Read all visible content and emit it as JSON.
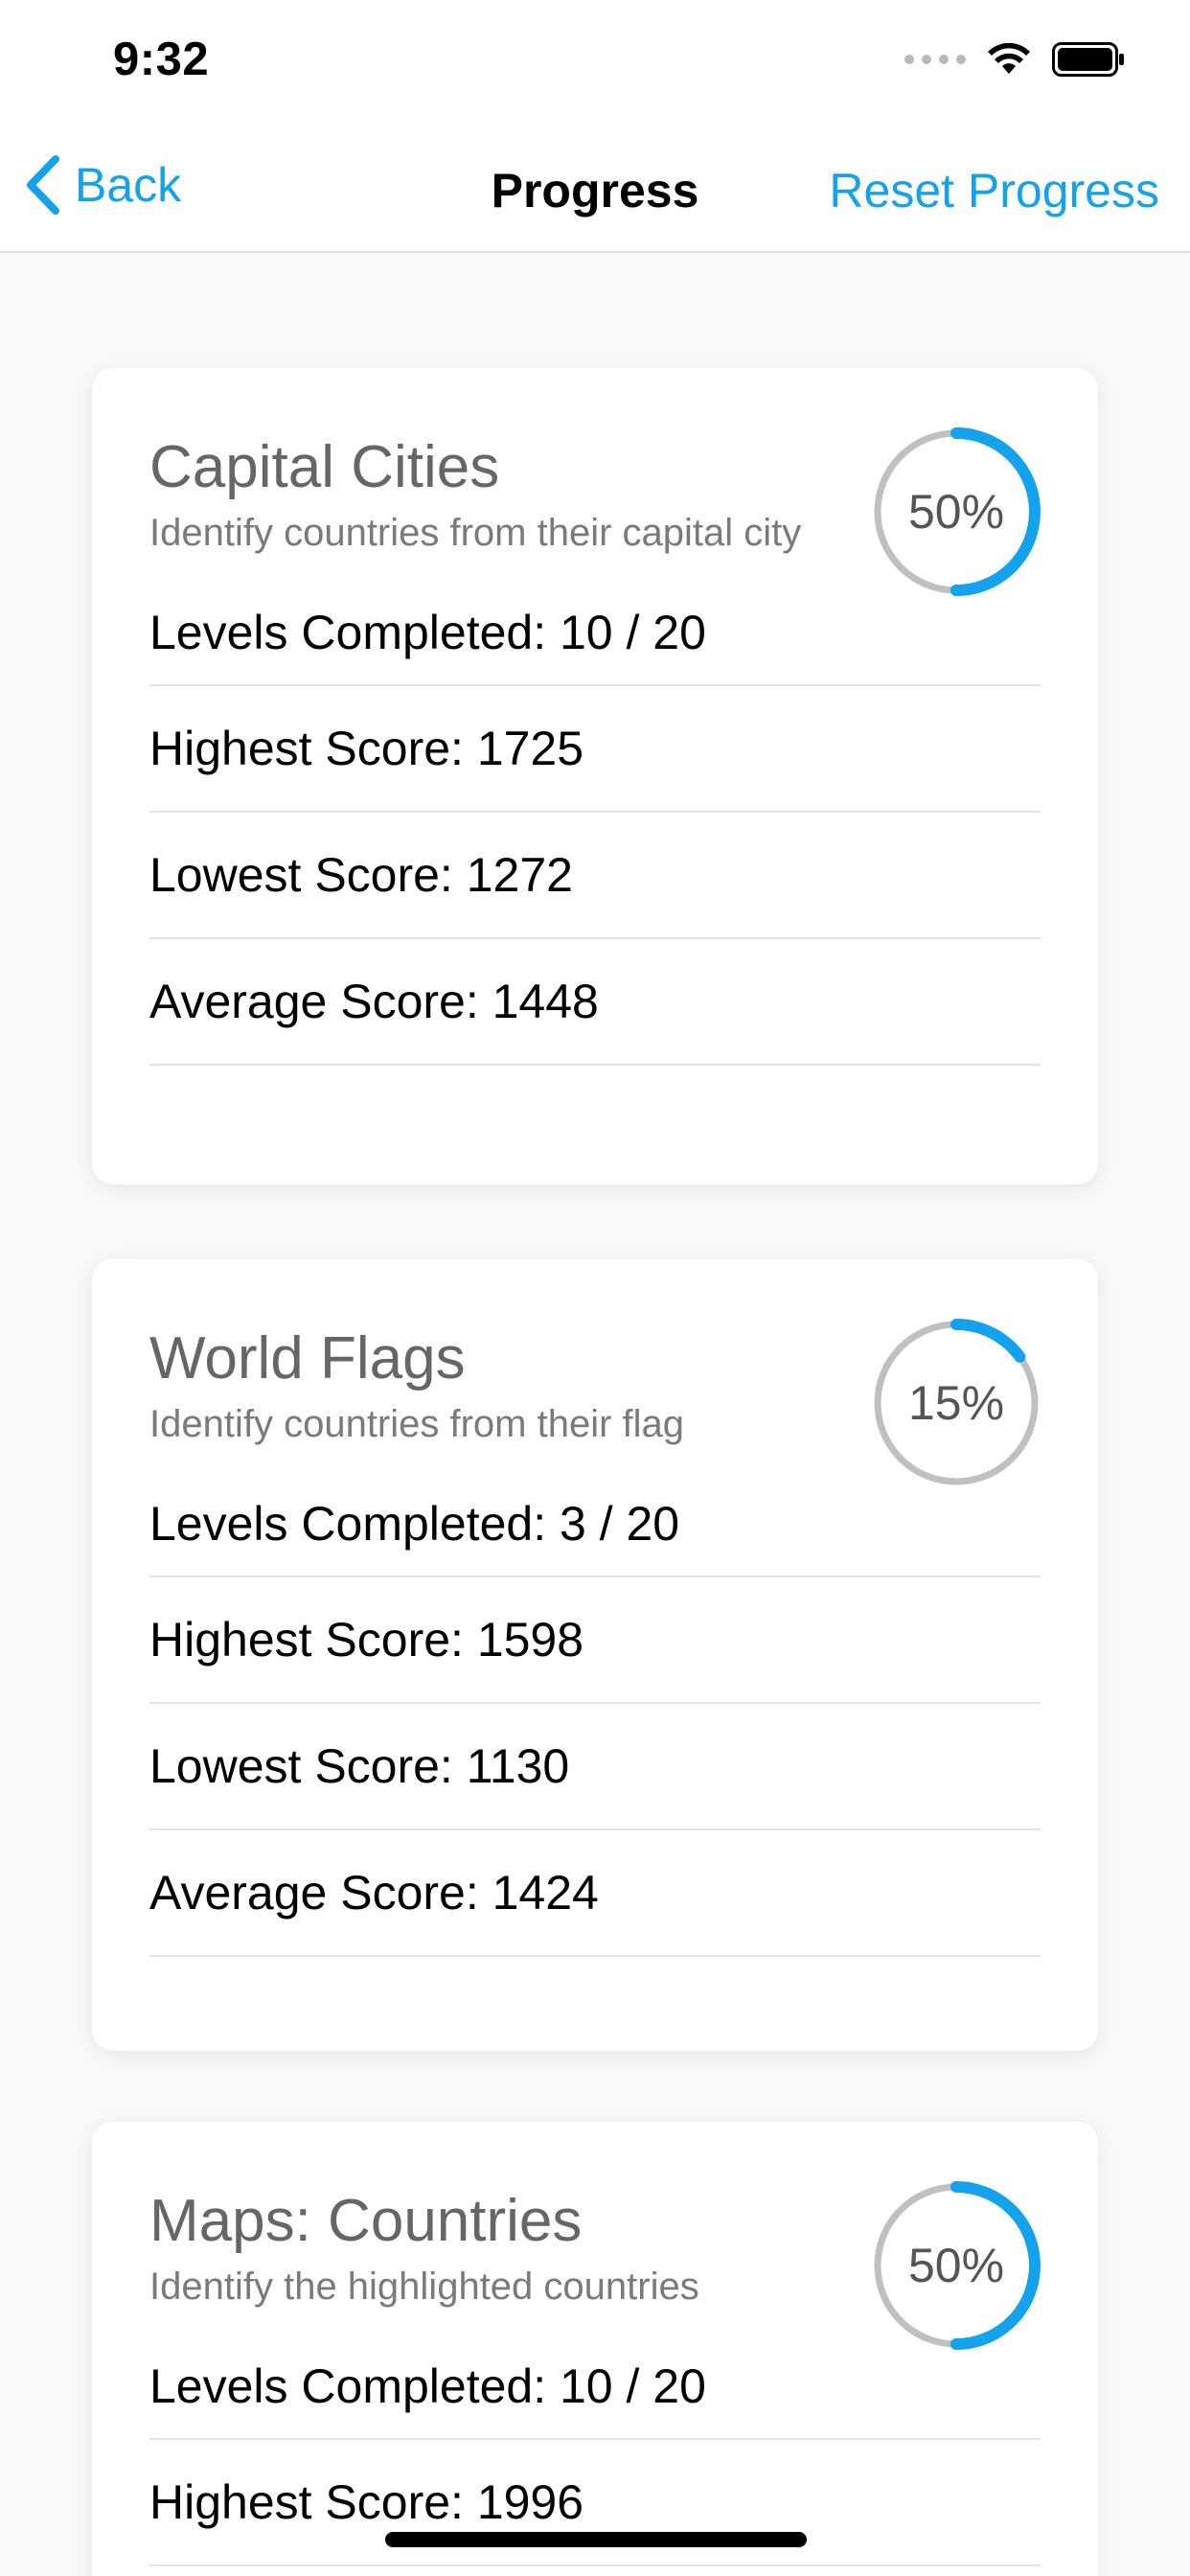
{
  "status": {
    "time": "9:32"
  },
  "nav": {
    "back_label": "Back",
    "title": "Progress",
    "reset_label": "Reset Progress"
  },
  "colors": {
    "accent": "#14a2ec",
    "ring_track": "#c0c0c0"
  },
  "cards": [
    {
      "title": "Capital Cities",
      "subtitle": "Identify countries from their capital city",
      "percent_label": "50%",
      "progress": 0.5,
      "stats": {
        "levels": "Levels Completed: 10 / 20",
        "highest": "Highest Score: 1725",
        "lowest": "Lowest Score: 1272",
        "average": "Average Score: 1448"
      }
    },
    {
      "title": "World Flags",
      "subtitle": "Identify countries from their flag",
      "percent_label": "15%",
      "progress": 0.15,
      "stats": {
        "levels": "Levels Completed: 3 / 20",
        "highest": "Highest Score: 1598",
        "lowest": "Lowest Score: 1130",
        "average": "Average Score: 1424"
      }
    },
    {
      "title": "Maps: Countries",
      "subtitle": "Identify the highlighted countries",
      "percent_label": "50%",
      "progress": 0.5,
      "stats": {
        "levels": "Levels Completed: 10 / 20",
        "highest": "Highest Score: 1996"
      }
    }
  ]
}
